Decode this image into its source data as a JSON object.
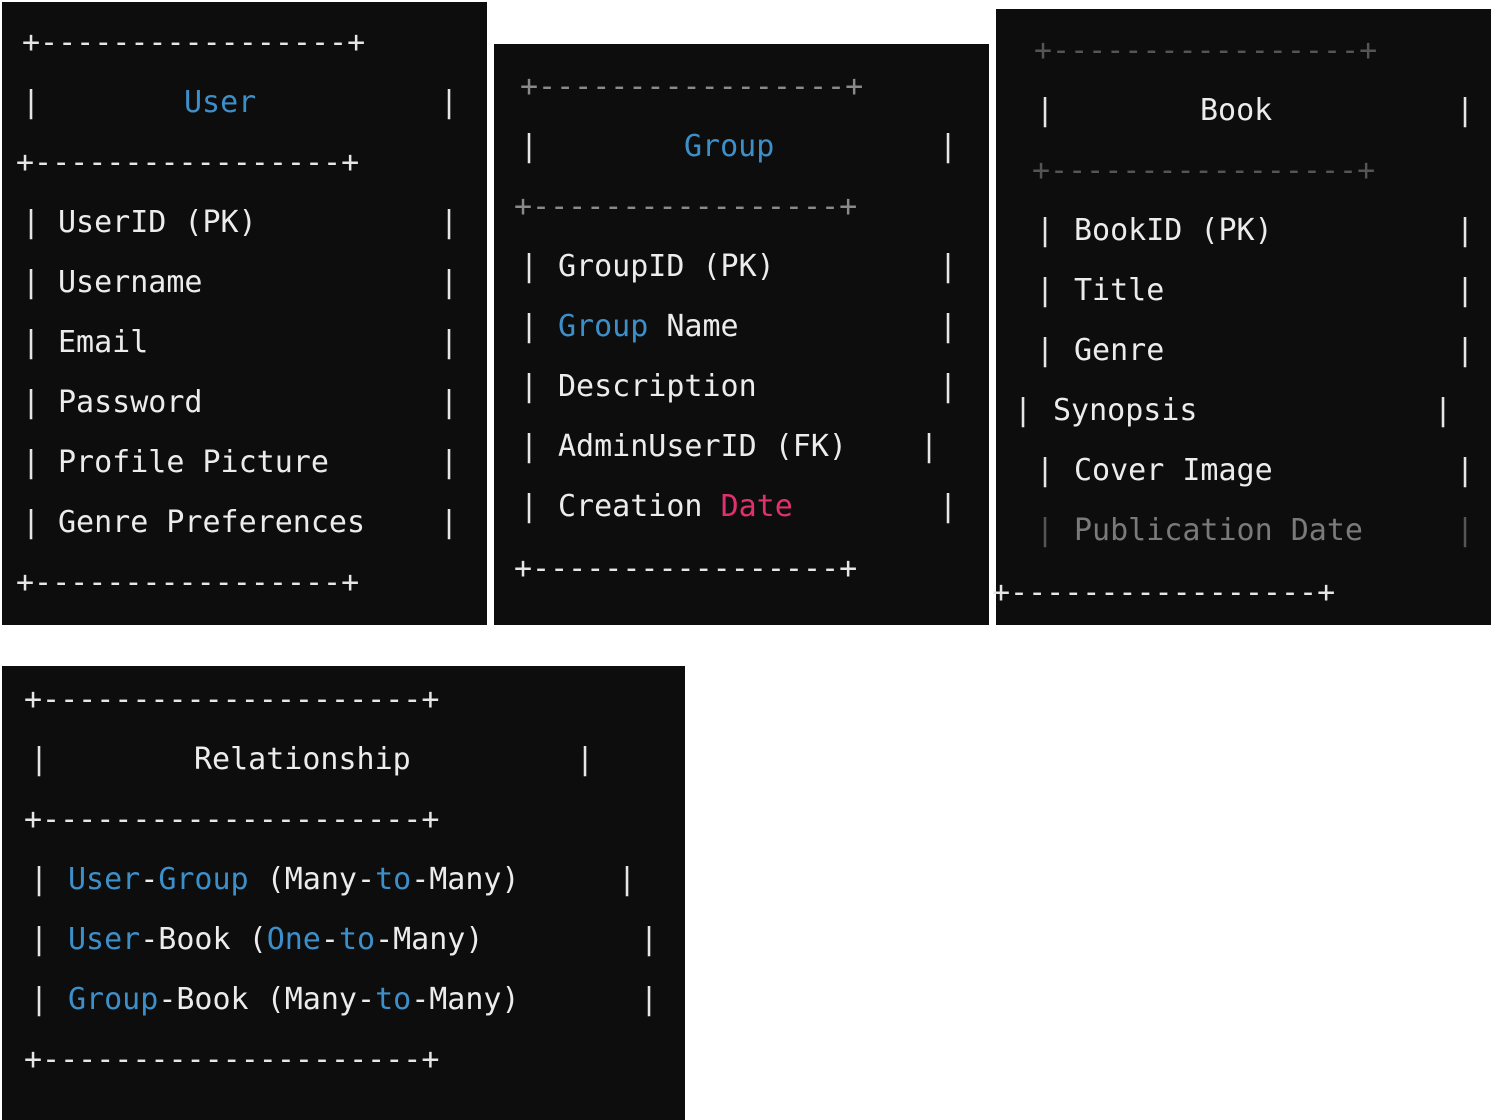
{
  "colors": {
    "panel_bg": "#0d0d0d",
    "keyword_blue": "#3d8fc9",
    "keyword_pink": "#e0306e",
    "text": "#ececec",
    "border": "#8a8a8a"
  },
  "user_table": {
    "title": "User",
    "border": "+-----------------+",
    "bar": "|",
    "fields": [
      "UserID (PK)",
      "Username",
      "Email",
      "Password",
      "Profile Picture",
      "Genre Preferences"
    ]
  },
  "group_table": {
    "title": "Group",
    "border": "+-----------------+",
    "bar": "|",
    "fields": {
      "f0": "GroupID (PK)",
      "f1_kw": "Group",
      "f1_rest": " Name",
      "f2": "Description",
      "f3": "AdminUserID (FK)",
      "f4_main": "Creation ",
      "f4_kw": "Date"
    }
  },
  "book_table": {
    "title": "Book",
    "border": "+-----------------+",
    "bar": "|",
    "fields": [
      "BookID (PK)",
      "Title",
      "Genre",
      "Synopsis",
      "Cover Image",
      "Publication Date"
    ]
  },
  "relationship_table": {
    "title": "Relationship",
    "border": "+---------------------+",
    "bar": "|",
    "rows": [
      [
        {
          "text": "User",
          "kw": true
        },
        {
          "text": "-",
          "kw": false
        },
        {
          "text": "Group",
          "kw": true
        },
        {
          "text": " (Many-",
          "kw": false
        },
        {
          "text": "to",
          "kw": true
        },
        {
          "text": "-Many)",
          "kw": false
        }
      ],
      [
        {
          "text": "User",
          "kw": true
        },
        {
          "text": "-Book (",
          "kw": false
        },
        {
          "text": "One",
          "kw": true
        },
        {
          "text": "-",
          "kw": false
        },
        {
          "text": "to",
          "kw": true
        },
        {
          "text": "-Many)",
          "kw": false
        }
      ],
      [
        {
          "text": "Group",
          "kw": true
        },
        {
          "text": "-Book (Many-",
          "kw": false
        },
        {
          "text": "to",
          "kw": true
        },
        {
          "text": "-Many)",
          "kw": false
        }
      ]
    ]
  }
}
